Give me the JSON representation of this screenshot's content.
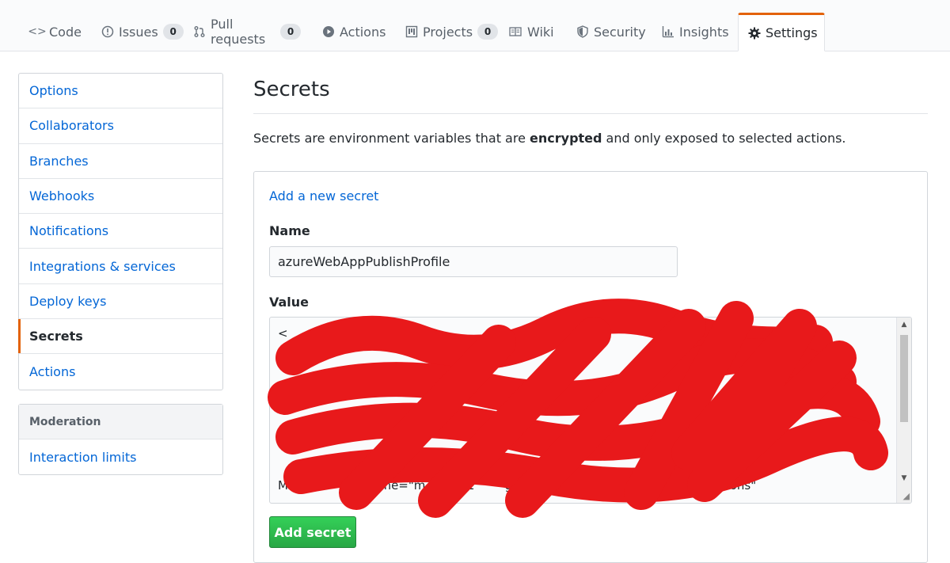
{
  "tabs": [
    {
      "label": "Code",
      "icon": "code-icon",
      "count": null
    },
    {
      "label": "Issues",
      "icon": "issue-icon",
      "count": "0"
    },
    {
      "label": "Pull requests",
      "icon": "pull-request-icon",
      "count": "0"
    },
    {
      "label": "Actions",
      "icon": "play-icon",
      "count": null
    },
    {
      "label": "Projects",
      "icon": "project-icon",
      "count": "0"
    },
    {
      "label": "Wiki",
      "icon": "book-icon",
      "count": null
    },
    {
      "label": "Security",
      "icon": "shield-icon",
      "count": null
    },
    {
      "label": "Insights",
      "icon": "graph-icon",
      "count": null
    },
    {
      "label": "Settings",
      "icon": "gear-icon",
      "count": null,
      "active": true
    }
  ],
  "sidebar": {
    "items": [
      {
        "label": "Options"
      },
      {
        "label": "Collaborators"
      },
      {
        "label": "Branches"
      },
      {
        "label": "Webhooks"
      },
      {
        "label": "Notifications"
      },
      {
        "label": "Integrations & services"
      },
      {
        "label": "Deploy keys"
      },
      {
        "label": "Secrets",
        "selected": true
      },
      {
        "label": "Actions"
      }
    ],
    "moderation_heading": "Moderation",
    "moderation_items": [
      {
        "label": "Interaction limits"
      }
    ]
  },
  "main": {
    "title": "Secrets",
    "description_prefix": "Secrets are environment variables that are ",
    "description_bold": "encrypted",
    "description_suffix": " and only exposed to selected actions.",
    "form": {
      "add_link": "Add a new secret",
      "name_label": "Name",
      "name_value": "azureWebAppPublishProfile",
      "value_label": "Value",
      "value_lines": [
        "<",
        "",
        "",
        "",
        "",
        "",
        "",
        "",
        "Mode=       sername=\"m       201        githubac         $mau201910githubactions\""
      ],
      "submit_label": "Add secret"
    }
  },
  "colors": {
    "accent_tab": "#e36209",
    "link": "#0366d6",
    "button": "#28a745",
    "redaction": "#e8191b"
  }
}
